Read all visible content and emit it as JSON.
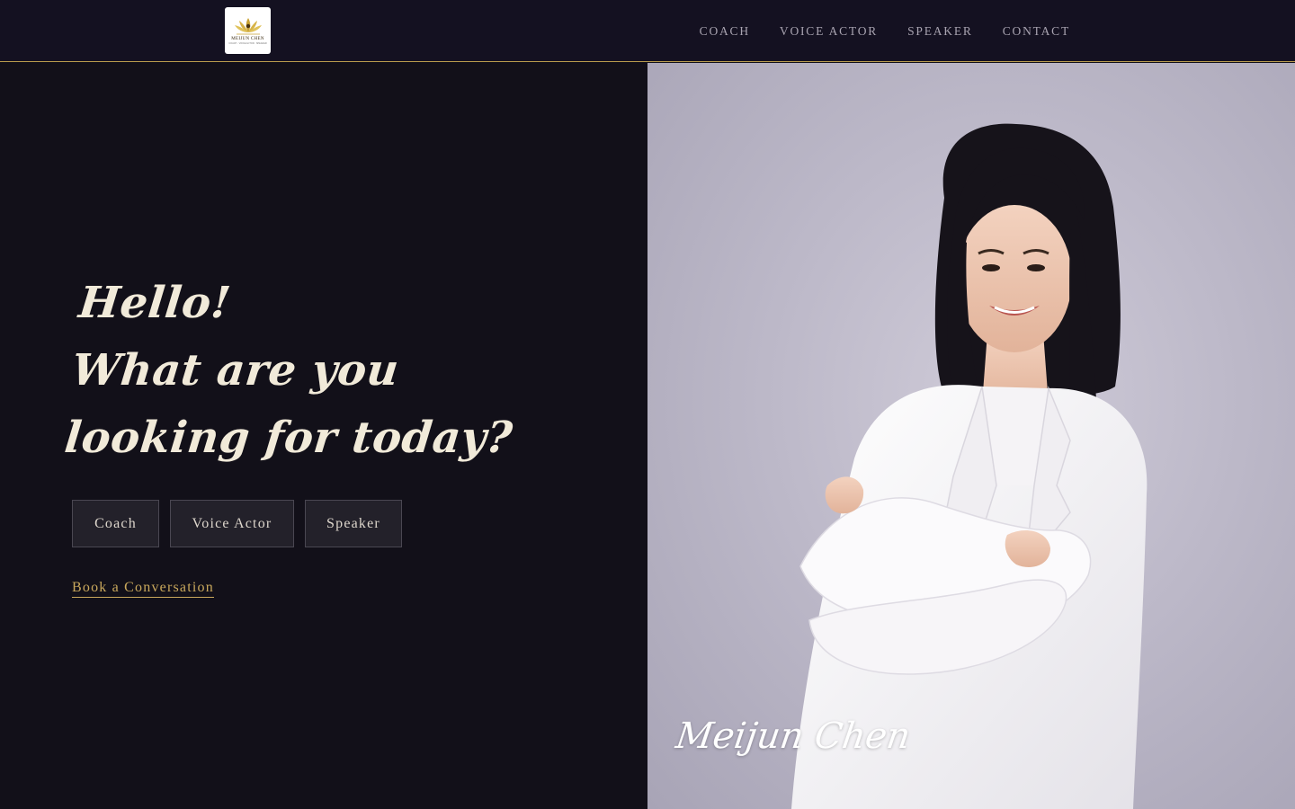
{
  "header": {
    "logo_text": "MEIJUN CHEN",
    "logo_sub": "COACH · VOICE ACTOR · SPEAKER",
    "nav": [
      {
        "label": "COACH"
      },
      {
        "label": "VOICE ACTOR"
      },
      {
        "label": "SPEAKER"
      },
      {
        "label": "CONTACT"
      }
    ]
  },
  "hero": {
    "line1": "Hello!",
    "line2": "What are you",
    "line3": "looking for today?",
    "buttons": {
      "coach": "Coach",
      "voice_actor": "Voice Actor",
      "speaker": "Speaker"
    },
    "book_link": "Book a Conversation"
  },
  "portrait": {
    "signature": "Meijun Chen"
  },
  "colors": {
    "background": "#121019",
    "header_border": "#b89b4c",
    "accent_gold": "#c9a85c",
    "headline": "#f1ead9"
  },
  "icons": {
    "logo": "lotus-logo-icon"
  }
}
